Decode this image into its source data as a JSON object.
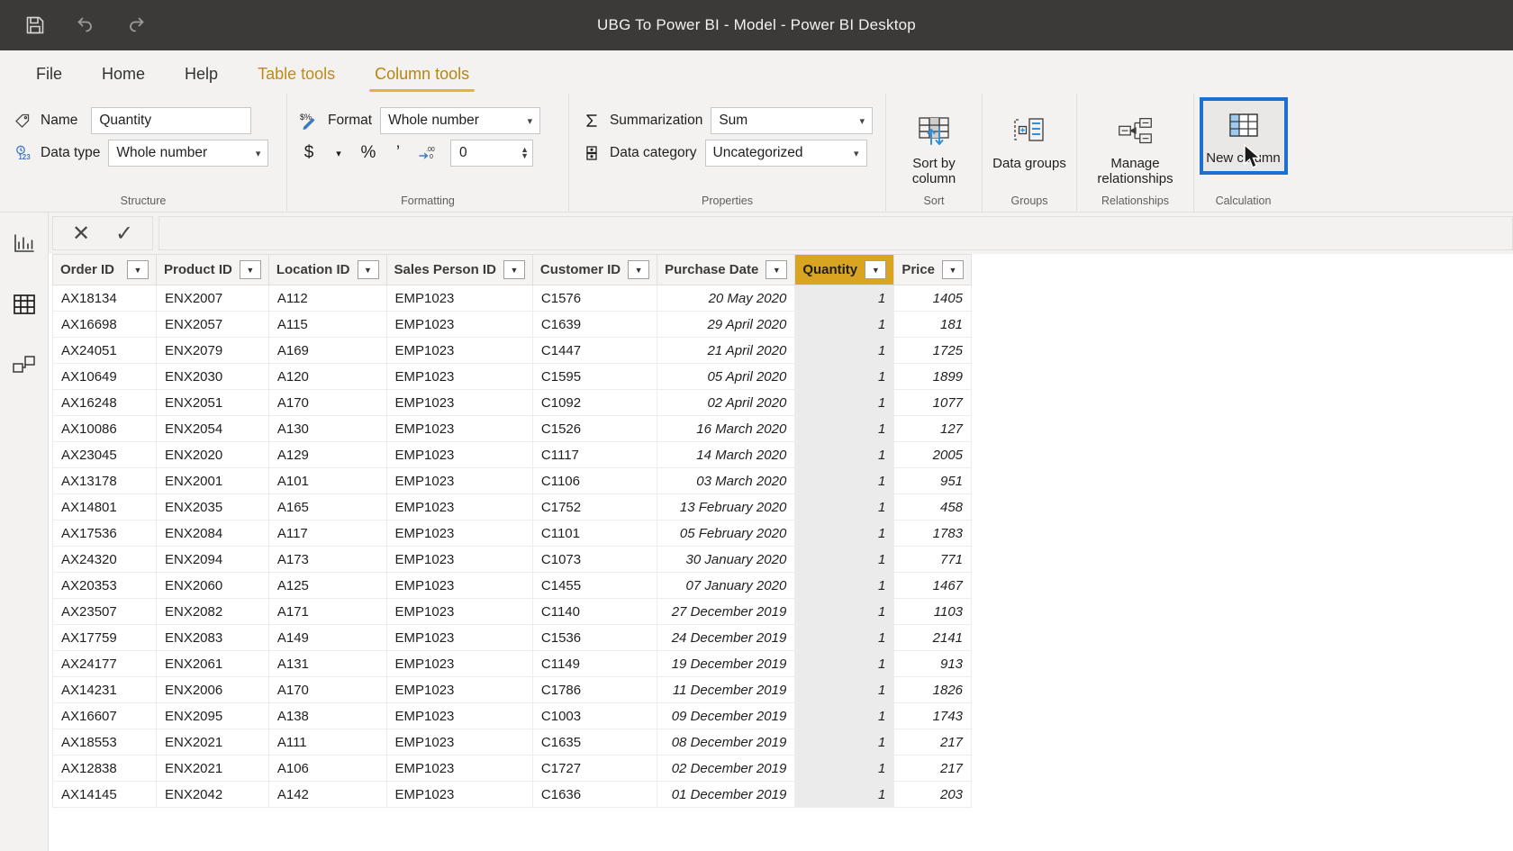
{
  "window": {
    "title": "UBG To Power BI - Model - Power BI Desktop",
    "quick_access": [
      {
        "name": "save-icon",
        "label": "Save"
      },
      {
        "name": "undo-icon",
        "label": "Undo"
      },
      {
        "name": "redo-icon",
        "label": "Redo"
      }
    ]
  },
  "ribbon": {
    "tabs": [
      {
        "label": "File",
        "state": "normal"
      },
      {
        "label": "Home",
        "state": "normal"
      },
      {
        "label": "Help",
        "state": "normal"
      },
      {
        "label": "Table tools",
        "state": "contextual"
      },
      {
        "label": "Column tools",
        "state": "active"
      }
    ],
    "groups": {
      "structure": {
        "label": "Structure",
        "name_label": "Name",
        "name_value": "Quantity",
        "datatype_label": "Data type",
        "datatype_value": "Whole number"
      },
      "formatting": {
        "label": "Formatting",
        "format_label": "Format",
        "format_value": "Whole number",
        "currency_symbol": "$",
        "percent_symbol": "%",
        "thousands_symbol": "’",
        "decimal_places_value": "0"
      },
      "properties": {
        "label": "Properties",
        "summarization_label": "Summarization",
        "summarization_value": "Sum",
        "datacategory_label": "Data category",
        "datacategory_value": "Uncategorized"
      },
      "sort": {
        "label": "Sort",
        "button": "Sort by column"
      },
      "groups": {
        "label": "Groups",
        "button": "Data groups"
      },
      "relationships": {
        "label": "Relationships",
        "button": "Manage relationships"
      },
      "calculation": {
        "label": "Calculation",
        "button": "New column",
        "highlighted": true
      }
    }
  },
  "view_rail": [
    {
      "label": "Report view",
      "icon": "report-chart-icon",
      "active": false
    },
    {
      "label": "Data view",
      "icon": "table-grid-icon",
      "active": true
    },
    {
      "label": "Model view",
      "icon": "model-relationship-icon",
      "active": false
    }
  ],
  "formula_bar": {
    "cancel_label": "✕",
    "accept_label": "✓",
    "value": "",
    "placeholder": ""
  },
  "accent_colors": {
    "selected_column_header": "#d9a520",
    "selected_column_cells": "#ebebeb",
    "ribbon_active_tab": "#b8860b",
    "highlight_outline": "#1d6fd0",
    "titlebar": "#3b3a39"
  },
  "table": {
    "columns": [
      {
        "label": "Order ID",
        "align": "left",
        "selected": false
      },
      {
        "label": "Product ID",
        "align": "left",
        "selected": false
      },
      {
        "label": "Location ID",
        "align": "left",
        "selected": false
      },
      {
        "label": "Sales Person ID",
        "align": "left",
        "selected": false
      },
      {
        "label": "Customer ID",
        "align": "left",
        "selected": false
      },
      {
        "label": "Purchase Date",
        "align": "right",
        "selected": false
      },
      {
        "label": "Quantity",
        "align": "right",
        "selected": true
      },
      {
        "label": "Price",
        "align": "right",
        "selected": false
      }
    ],
    "rows": [
      [
        "AX18134",
        "ENX2007",
        "A112",
        "EMP1023",
        "C1576",
        "20 May 2020",
        "1",
        "1405"
      ],
      [
        "AX16698",
        "ENX2057",
        "A115",
        "EMP1023",
        "C1639",
        "29 April 2020",
        "1",
        "181"
      ],
      [
        "AX24051",
        "ENX2079",
        "A169",
        "EMP1023",
        "C1447",
        "21 April 2020",
        "1",
        "1725"
      ],
      [
        "AX10649",
        "ENX2030",
        "A120",
        "EMP1023",
        "C1595",
        "05 April 2020",
        "1",
        "1899"
      ],
      [
        "AX16248",
        "ENX2051",
        "A170",
        "EMP1023",
        "C1092",
        "02 April 2020",
        "1",
        "1077"
      ],
      [
        "AX10086",
        "ENX2054",
        "A130",
        "EMP1023",
        "C1526",
        "16 March 2020",
        "1",
        "127"
      ],
      [
        "AX23045",
        "ENX2020",
        "A129",
        "EMP1023",
        "C1117",
        "14 March 2020",
        "1",
        "2005"
      ],
      [
        "AX13178",
        "ENX2001",
        "A101",
        "EMP1023",
        "C1106",
        "03 March 2020",
        "1",
        "951"
      ],
      [
        "AX14801",
        "ENX2035",
        "A165",
        "EMP1023",
        "C1752",
        "13 February 2020",
        "1",
        "458"
      ],
      [
        "AX17536",
        "ENX2084",
        "A117",
        "EMP1023",
        "C1101",
        "05 February 2020",
        "1",
        "1783"
      ],
      [
        "AX24320",
        "ENX2094",
        "A173",
        "EMP1023",
        "C1073",
        "30 January 2020",
        "1",
        "771"
      ],
      [
        "AX20353",
        "ENX2060",
        "A125",
        "EMP1023",
        "C1455",
        "07 January 2020",
        "1",
        "1467"
      ],
      [
        "AX23507",
        "ENX2082",
        "A171",
        "EMP1023",
        "C1140",
        "27 December 2019",
        "1",
        "1103"
      ],
      [
        "AX17759",
        "ENX2083",
        "A149",
        "EMP1023",
        "C1536",
        "24 December 2019",
        "1",
        "2141"
      ],
      [
        "AX24177",
        "ENX2061",
        "A131",
        "EMP1023",
        "C1149",
        "19 December 2019",
        "1",
        "913"
      ],
      [
        "AX14231",
        "ENX2006",
        "A170",
        "EMP1023",
        "C1786",
        "11 December 2019",
        "1",
        "1826"
      ],
      [
        "AX16607",
        "ENX2095",
        "A138",
        "EMP1023",
        "C1003",
        "09 December 2019",
        "1",
        "1743"
      ],
      [
        "AX18553",
        "ENX2021",
        "A111",
        "EMP1023",
        "C1635",
        "08 December 2019",
        "1",
        "217"
      ],
      [
        "AX12838",
        "ENX2021",
        "A106",
        "EMP1023",
        "C1727",
        "02 December 2019",
        "1",
        "217"
      ],
      [
        "AX14145",
        "ENX2042",
        "A142",
        "EMP1023",
        "C1636",
        "01 December 2019",
        "1",
        "203"
      ]
    ]
  }
}
